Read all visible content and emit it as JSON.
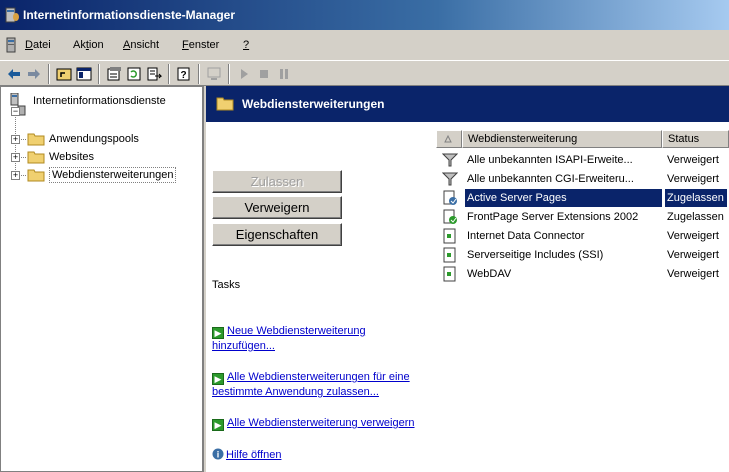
{
  "window": {
    "title": "Internetinformationsdienste-Manager"
  },
  "menu": {
    "items": [
      {
        "pre": "",
        "ul": "D",
        "post": "atei"
      },
      {
        "pre": "Ak",
        "ul": "t",
        "post": "ion"
      },
      {
        "pre": "",
        "ul": "A",
        "post": "nsicht"
      },
      {
        "pre": "",
        "ul": "F",
        "post": "enster"
      },
      {
        "pre": "",
        "ul": "?",
        "post": ""
      }
    ]
  },
  "toolbar": {
    "icons": [
      "back-icon",
      "forward-icon",
      "up-level-icon",
      "show-hide-tree-icon",
      "properties-icon",
      "refresh-icon",
      "export-list-icon",
      "help-icon",
      "computer-icon",
      "play-icon",
      "stop-icon",
      "pause-icon"
    ]
  },
  "tree": {
    "root": "Internetinformationsdienste",
    "children": [
      "Anwendungspools",
      "Websites",
      "Webdiensterweiterungen"
    ]
  },
  "panel": {
    "title": "Webdiensterweiterungen",
    "buttons": {
      "allow": "Zulassen",
      "deny": "Verweigern",
      "properties": "Eigenschaften"
    },
    "tasks_label": "Tasks",
    "tasks": [
      {
        "line1": "Neue Webdiensterweiterung",
        "line2": "hinzufügen..."
      },
      {
        "line1": "Alle Webdiensterweiterungen für eine",
        "line2": "bestimmte Anwendung zulassen..."
      },
      {
        "line1": "Alle Webdiensterweiterung verweigern",
        "line2": ""
      },
      {
        "line1": "Hilfe öffnen",
        "line2": ""
      }
    ]
  },
  "list": {
    "columns": {
      "name": "Webdiensterweiterung",
      "status": "Status"
    },
    "rows": [
      {
        "name": "Alle unbekannten ISAPI-Erweite...",
        "status": "Verweigert",
        "icon": "filter-icon"
      },
      {
        "name": "Alle unbekannten CGI-Erweiteru...",
        "status": "Verweigert",
        "icon": "filter-icon"
      },
      {
        "name": "Active Server Pages",
        "status": "Zugelassen",
        "icon": "asp-extension-icon"
      },
      {
        "name": "FrontPage Server Extensions 2002",
        "status": "Zugelassen",
        "icon": "frontpage-extension-icon"
      },
      {
        "name": "Internet Data Connector",
        "status": "Verweigert",
        "icon": "extension-icon"
      },
      {
        "name": "Serverseitige Includes (SSI)",
        "status": "Verweigert",
        "icon": "extension-icon"
      },
      {
        "name": "WebDAV",
        "status": "Verweigert",
        "icon": "extension-icon"
      }
    ],
    "selected_index": 2
  },
  "colors": {
    "title_start": "#0a246a",
    "title_end": "#a6caf0",
    "selection": "#0a246a",
    "link": "#0000cc",
    "face": "#d4d0c8"
  }
}
